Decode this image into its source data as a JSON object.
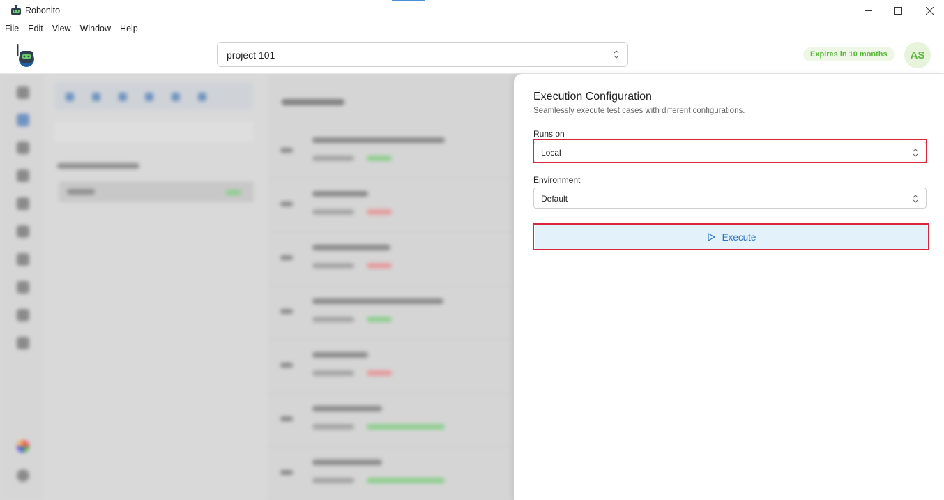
{
  "window": {
    "title": "Robonito"
  },
  "menu": [
    "File",
    "Edit",
    "View",
    "Window",
    "Help"
  ],
  "header": {
    "project": "project 101",
    "expires_badge": "Expires in 10 months",
    "avatar_initials": "AS"
  },
  "panel": {
    "title": "Execution Configuration",
    "subtitle": "Seamlessly execute test cases with different configurations.",
    "runs_on_label": "Runs on",
    "runs_on_value": "Local",
    "environment_label": "Environment",
    "environment_value": "Default",
    "execute_label": "Execute"
  },
  "colors": {
    "highlight": "#d7263d",
    "accent": "#2a72c4",
    "badge_green": "#5cb83d"
  }
}
